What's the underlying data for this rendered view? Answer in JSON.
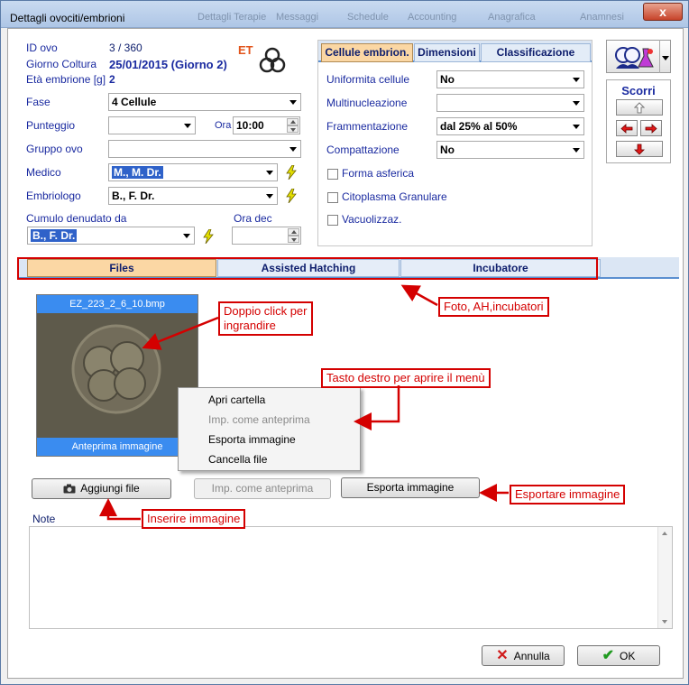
{
  "window": {
    "title": "Dettagli ovociti/embrioni",
    "close_label": "x",
    "ghost_tabs": [
      "Dettagli Terapie",
      "Messaggi",
      "Schedule",
      "Accounting",
      "Anagrafica",
      "Anamnesi"
    ]
  },
  "header": {
    "id_label": "ID ovo",
    "id_value": "3 / 360",
    "giorno_label": "Giorno Coltura",
    "giorno_value": "25/01/2015  (Giorno 2)",
    "eta_label": "Età embrione [g]",
    "eta_value": "2",
    "et_badge": "ET"
  },
  "form": {
    "fase_label": "Fase",
    "fase_value": "4 Cellule",
    "punteggio_label": "Punteggio",
    "punteggio_value": "",
    "ora_label": "Ora",
    "ora_value": "10:00",
    "gruppo_label": "Gruppo ovo",
    "gruppo_value": "",
    "medico_label": "Medico",
    "medico_value": "M., M. Dr.",
    "embriologo_label": "Embriologo",
    "embriologo_value": "B., F. Dr.",
    "cumulo_label": "Cumulo denudato da",
    "cumulo_value": "B., F. Dr.",
    "oradec_label": "Ora dec",
    "oradec_value": ""
  },
  "cell_panel": {
    "tabs": [
      "Cellule embrion.",
      "Dimensioni",
      "Classificazione"
    ],
    "uniformita_label": "Uniformita cellule",
    "uniformita_value": "No",
    "multinucleazione_label": "Multinucleazione",
    "multinucleazione_value": "",
    "frammentazione_label": "Frammentazione",
    "frammentazione_value": "dal 25% al 50%",
    "compattazione_label": "Compattazione",
    "compattazione_value": "No",
    "checkboxes": [
      "Forma asferica",
      "Citoplasma Granulare",
      "Vacuolizzaz."
    ]
  },
  "scorri": {
    "title": "Scorri"
  },
  "bottom_tabs": [
    "Files",
    "Assisted Hatching",
    "Incubatore"
  ],
  "files": {
    "thumb_filename": "EZ_223_2_6_10.bmp",
    "thumb_caption": "Anteprima immagine",
    "context_menu": [
      "Apri cartella",
      "Imp. come anteprima",
      "Esporta immagine",
      "Cancella file"
    ],
    "add_button": "Aggiungi file",
    "preview_button": "Imp. come anteprima",
    "export_button": "Esporta immagine",
    "notes_label": "Note"
  },
  "annotations": {
    "foto": "Foto, AH,incubatori",
    "doppio_line1": "Doppio click per",
    "doppio_line2": "ingrandire",
    "tasto": "Tasto destro per aprire il menù",
    "esportare": "Esportare immagine",
    "inserire": "Inserire immagine"
  },
  "footer": {
    "cancel_button": "Annulla",
    "ok_button": "OK"
  },
  "colors": {
    "label_blue": "#1a2aa0",
    "annotation_red": "#d40000",
    "tab_active": "#fbd7a4"
  }
}
